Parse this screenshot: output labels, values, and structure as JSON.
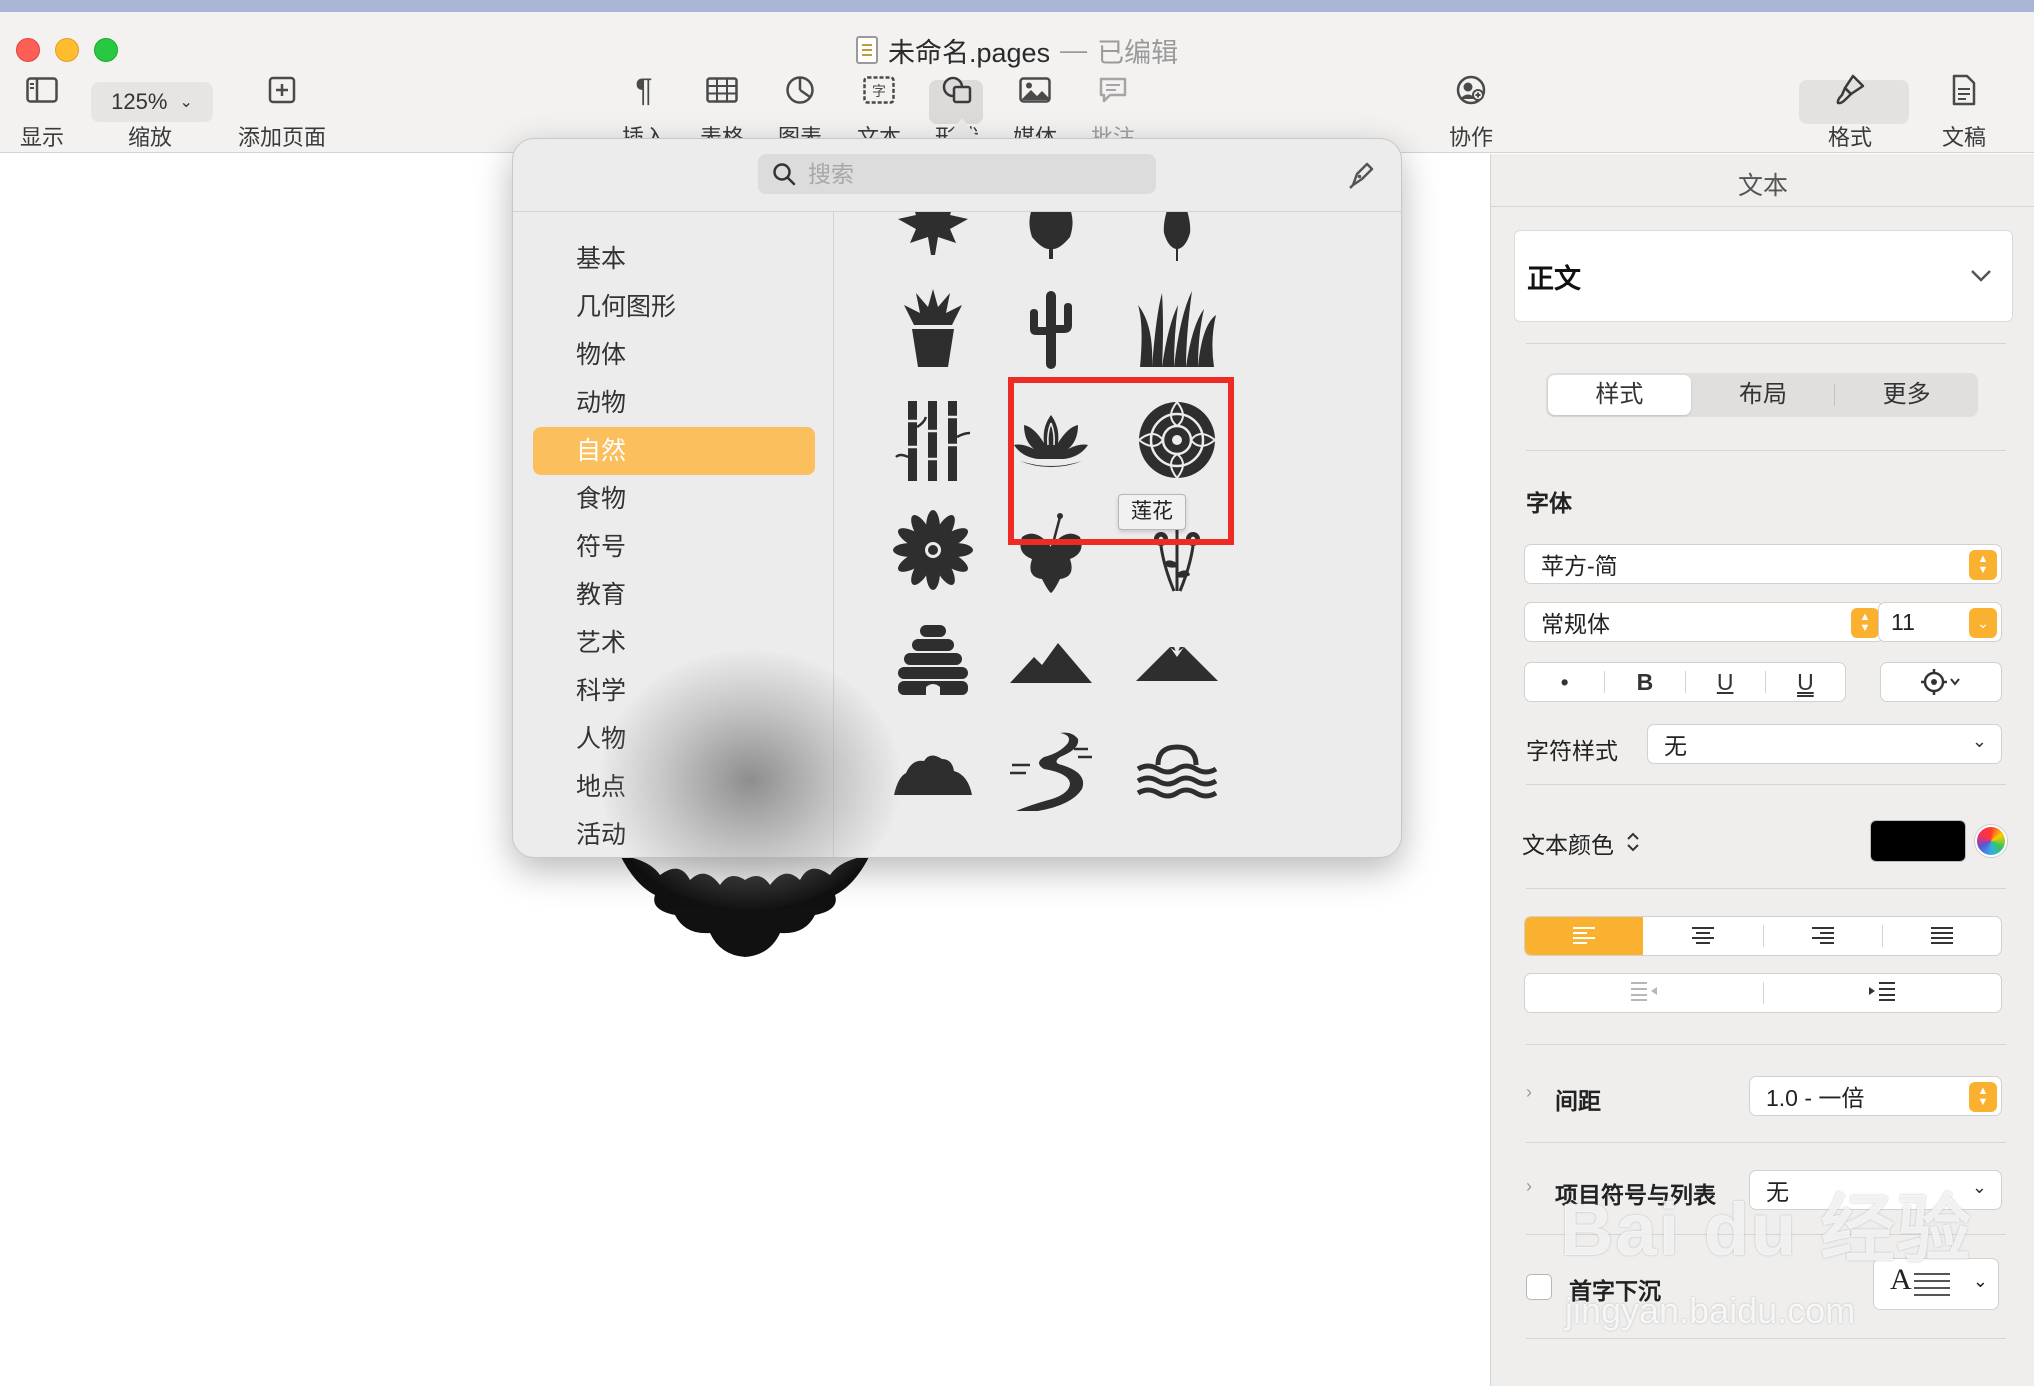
{
  "window": {
    "doc_name": "未命名.pages",
    "separator": "—",
    "edited": "已编辑"
  },
  "toolbar": {
    "view_label": "显示",
    "zoom_value": "125%",
    "zoom_label": "缩放",
    "add_page_label": "添加页面",
    "insert_label": "插入",
    "table_label": "表格",
    "chart_label": "图表",
    "text_label": "文本",
    "shape_label": "形状",
    "media_label": "媒体",
    "comment_label": "批注",
    "collab_label": "协作",
    "format_label": "格式",
    "document_label": "文稿"
  },
  "shape_library": {
    "search_placeholder": "搜索",
    "categories": [
      "基本",
      "几何图形",
      "物体",
      "动物",
      "自然",
      "食物",
      "符号",
      "教育",
      "艺术",
      "科学",
      "人物",
      "地点",
      "活动"
    ],
    "selected_category": "自然",
    "shapes": [
      "maple-leaf",
      "round-leaf",
      "teardrop-leaf",
      "potted-plant",
      "cactus",
      "grass",
      "bamboo",
      "lotus",
      "rose",
      "daisy",
      "hibiscus",
      "flowers",
      "beehive",
      "mountains",
      "volcano",
      "hill",
      "river",
      "sunset-waves"
    ],
    "tooltip": "莲花"
  },
  "inspector": {
    "title": "文本",
    "paragraph_style": "正文",
    "tabs": [
      "样式",
      "布局",
      "更多"
    ],
    "active_tab": "样式",
    "font_heading": "字体",
    "font_family": "苹方-简",
    "font_style": "常规体",
    "font_size": "11",
    "style_buttons": [
      "•",
      "B",
      "U",
      "U"
    ],
    "char_style_label": "字符样式",
    "char_style_value": "无",
    "text_color_label": "文本颜色",
    "text_color": "#000000",
    "spacing_label": "间距",
    "spacing_value": "1.0 - 一倍",
    "bullets_label": "项目符号与列表",
    "bullets_value": "无",
    "dropcap_label": "首字下沉",
    "dropcap_glyph": "A"
  },
  "accent_color": "#fbb130",
  "highlight_color": "#ee2a24",
  "watermark": {
    "main": "Bai du 经验",
    "sub": "jingyan.baidu.com"
  }
}
